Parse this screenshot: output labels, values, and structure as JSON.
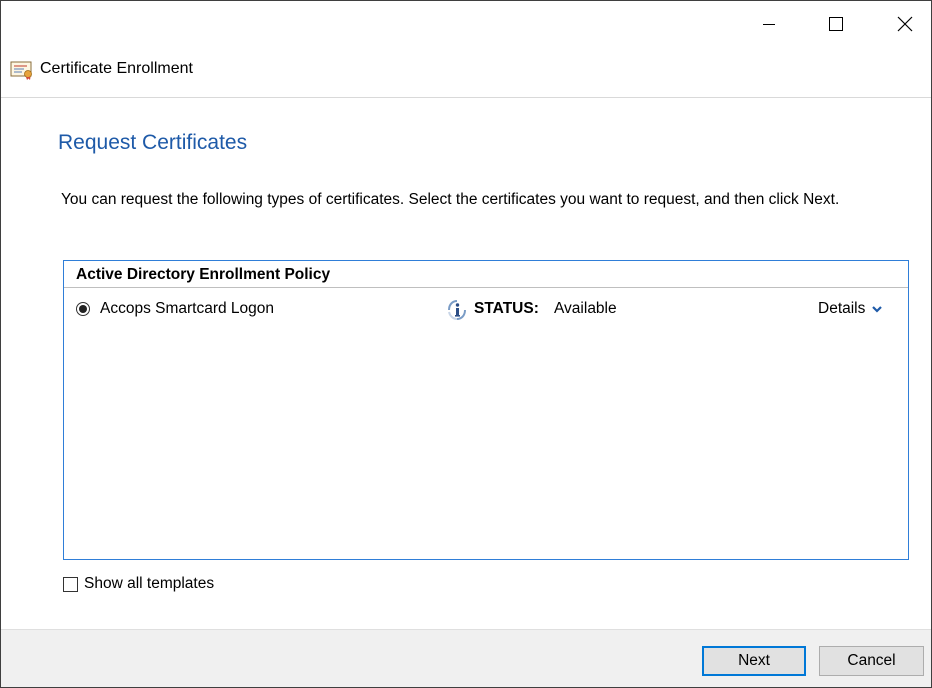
{
  "window": {
    "title": "Certificate Enrollment",
    "controls": {
      "minimize": "minimize-icon",
      "maximize": "maximize-icon",
      "close": "close-icon"
    }
  },
  "page": {
    "heading": "Request Certificates",
    "instructions": "You can request the following types of certificates. Select the certificates you want to request, and then click Next."
  },
  "policy": {
    "header": "Active Directory Enrollment Policy",
    "items": [
      {
        "name": "Accops Smartcard Logon",
        "selected": true,
        "status_label": "STATUS:",
        "status_value": "Available",
        "details_label": "Details"
      }
    ]
  },
  "options": {
    "show_all_templates_label": "Show all templates",
    "show_all_templates_checked": false
  },
  "footer": {
    "next_label": "Next",
    "cancel_label": "Cancel"
  },
  "colors": {
    "heading": "#1e5aa8",
    "policy_border": "#2f7ed8",
    "default_button_border": "#0078d7",
    "footer_background": "#f0f0f0"
  }
}
